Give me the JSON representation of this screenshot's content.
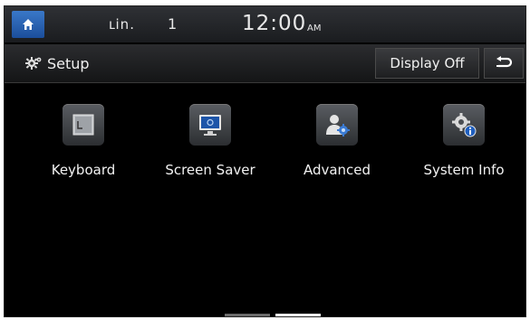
{
  "status_bar": {
    "home_icon": "home-icon",
    "signal_text": "ւin.",
    "channel": "1",
    "time": "12:00",
    "ampm": "AM"
  },
  "header": {
    "title": "Setup",
    "title_icon": "gear-icon",
    "display_off_label": "Display Off",
    "back_icon": "back-arrow-icon"
  },
  "menu": {
    "items": [
      {
        "label": "Keyboard",
        "icon": "keyboard-icon"
      },
      {
        "label": "Screen Saver",
        "icon": "monitor-icon"
      },
      {
        "label": "Advanced",
        "icon": "advanced-settings-icon"
      },
      {
        "label": "System Info",
        "icon": "system-info-icon"
      }
    ]
  },
  "pager": {
    "pages": 2,
    "active_index": 1
  },
  "colors": {
    "home_button": "#2a63b5",
    "background": "#000000",
    "text": "#f0f0f0"
  }
}
